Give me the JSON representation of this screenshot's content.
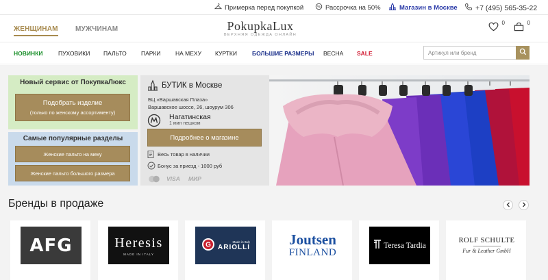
{
  "topbar": {
    "fitting": "Примерка перед покупкой",
    "installment": "Рассрочка на 50%",
    "store": "Магазин в Москве",
    "phone": "+7 (495) 565-35-22"
  },
  "header": {
    "tab_women": "ЖЕНЩИНАМ",
    "tab_men": "МУЖЧИНАМ",
    "logo_text": "PokupkaLux",
    "logo_tagline": "ВЕРХНЯЯ ОДЕЖДА ОНЛАЙН",
    "favorites_count": "0",
    "cart_count": "0"
  },
  "nav": {
    "items": [
      "НОВИНКИ",
      "ПУХОВИКИ",
      "ПАЛЬТО",
      "ПАРКИ",
      "НА МЕХУ",
      "КУРТКИ",
      "БОЛЬШИЕ РАЗМЕРЫ",
      "ВЕСНА",
      "SALE"
    ],
    "search_placeholder": "Артикул или бренд"
  },
  "promo": {
    "service_title": "Новый сервис от ПокупкаЛюкс",
    "service_button": "Подобрать изделие",
    "service_button_note": "(только по женскому ассортименту)",
    "popular_title": "Самые популярные разделы",
    "popular_links": [
      "Женские пальто на меху",
      "Женские пальто большого размера"
    ]
  },
  "boutique": {
    "title": "БУТИК в Москве",
    "address_line1": "БЦ «Варшавская Плаза»",
    "address_line2": "Варшавское шоссе, 26, шоурум 306",
    "metro": "Нагатинская",
    "walk": "1 мин пешком",
    "button": "Подробнее о магазине",
    "feature1": "Весь товар в наличии",
    "feature2": "Бонус за приезд - 1000 руб",
    "pay_visa": "VISA",
    "pay_mir": "МИР"
  },
  "brands": {
    "title": "Бренды в продаже",
    "items": [
      {
        "name": "AFG"
      },
      {
        "name": "Heresis",
        "note": "MADE IN ITALY"
      },
      {
        "name": "Ariolli",
        "note": "Made in Italy"
      },
      {
        "name": "Joutsen",
        "line2": "FINLAND"
      },
      {
        "name": "Teresa Tardia"
      },
      {
        "name": "ROLF SCHULTE",
        "line2": "Fur & Leather GmbH"
      }
    ]
  },
  "colors": {
    "gold": "#a68c5c",
    "green_nav": "#1a8f2a",
    "navy_nav": "#1a2f8a",
    "sale_red": "#d0142c",
    "service_bg": "#d5ecc4",
    "popular_bg": "#c9daeb"
  }
}
